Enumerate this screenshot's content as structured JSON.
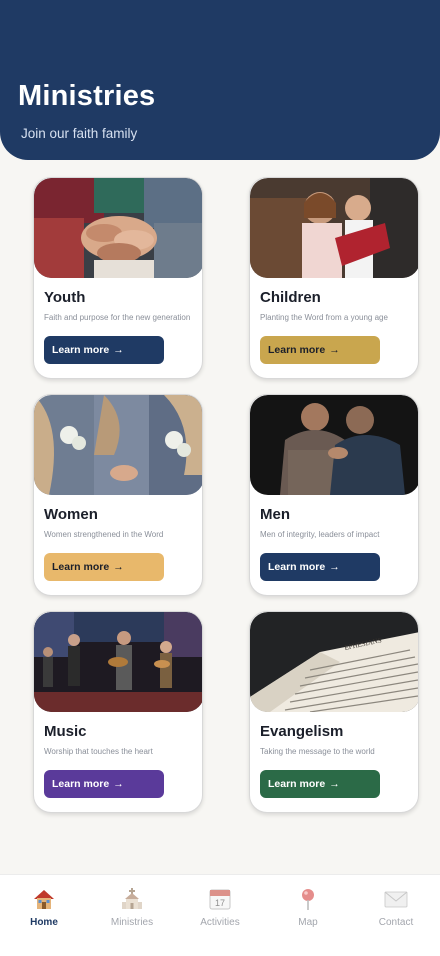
{
  "header": {
    "title": "Ministries",
    "subtitle": "Join our faith family",
    "bg_color": "#1f3a64"
  },
  "cards": [
    {
      "title": "Youth",
      "description": "Faith and purpose for the new generation",
      "button_label": "Learn more",
      "button_color": "#1f3a64",
      "button_text_color": "#ffffff",
      "image": "hands-together-photo"
    },
    {
      "title": "Children",
      "description": "Planting the Word from a young age",
      "button_label": "Learn more",
      "button_color": "#c9a64e",
      "button_text_color": "#1b1f2a",
      "image": "children-reading-photo"
    },
    {
      "title": "Women",
      "description": "Women strengthened in the Word",
      "button_label": "Learn more",
      "button_color": "#e8b86b",
      "button_text_color": "#1b1f2a",
      "image": "women-flowers-photo"
    },
    {
      "title": "Men",
      "description": "Men of integrity, leaders of impact",
      "button_label": "Learn more",
      "button_color": "#1f3a64",
      "button_text_color": "#ffffff",
      "image": "men-praying-photo"
    },
    {
      "title": "Music",
      "description": "Worship that touches the heart",
      "button_label": "Learn more",
      "button_color": "#5a3a9a",
      "button_text_color": "#ffffff",
      "image": "worship-band-photo"
    },
    {
      "title": "Evangelism",
      "description": "Taking the message to the world",
      "button_label": "Learn more",
      "button_color": "#2b6a47",
      "button_text_color": "#ffffff",
      "image": "open-bible-photo"
    }
  ],
  "arrow_glyph": "→",
  "bible_text": "EPHESIANS",
  "nav": [
    {
      "label": "Home",
      "icon": "house-icon",
      "active": true
    },
    {
      "label": "Ministries",
      "icon": "church-icon",
      "active": false
    },
    {
      "label": "Activities",
      "icon": "calendar-icon",
      "active": false
    },
    {
      "label": "Map",
      "icon": "map-pin-icon",
      "active": false
    },
    {
      "label": "Contact",
      "icon": "envelope-icon",
      "active": false
    }
  ],
  "calendar_day": "17"
}
